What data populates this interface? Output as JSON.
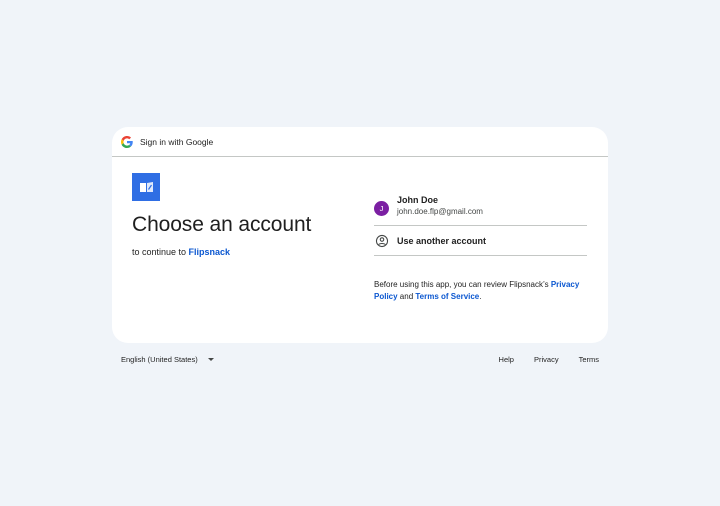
{
  "header": {
    "text": "Sign in with Google",
    "logo_icon": "google-g-icon"
  },
  "app": {
    "logo_icon": "flipsnack-logo-icon",
    "logo_color": "#2f6ee4"
  },
  "main": {
    "title": "Choose an account",
    "subtitle_prefix": "to continue to ",
    "app_name": "Flipsnack"
  },
  "account": {
    "initial": "J",
    "name": "John Doe",
    "email": "john.doe.flp@gmail.com",
    "avatar_color": "#7b1fa2"
  },
  "another_account": {
    "label": "Use another account",
    "icon": "account-circle-icon"
  },
  "policy": {
    "prefix": "Before using this app, you can review Flipsnack’s ",
    "privacy_link": "Privacy Policy",
    "and": " and ",
    "terms_link": "Terms of Service",
    "suffix": "."
  },
  "footer": {
    "language": "English (United States)",
    "help": "Help",
    "privacy": "Privacy",
    "terms": "Terms"
  },
  "colors": {
    "link": "#0b57d0",
    "background": "#f0f4f9"
  }
}
